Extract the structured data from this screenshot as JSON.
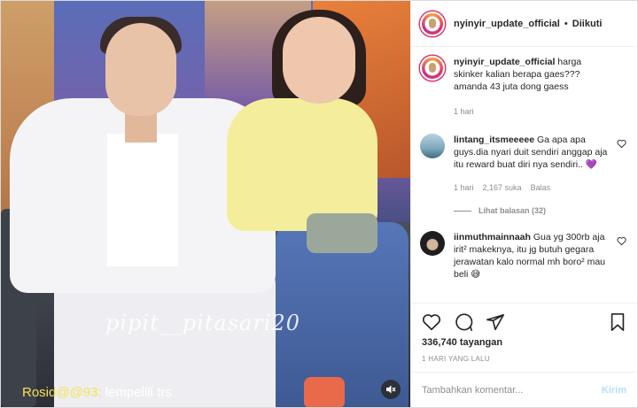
{
  "media": {
    "watermark": "pipit__pitasari20",
    "overlay_caption_user": "Rosid@@93:",
    "overlay_caption_text": "lempellll trs",
    "sound_icon": "speaker-muted-icon"
  },
  "header": {
    "username": "nyinyir_update_official",
    "separator": "•",
    "follow_state": "Diikuti"
  },
  "caption": {
    "username": "nyinyir_update_official",
    "text": "harga skinker kalian berapa gaes???",
    "line2": "amanda 43 juta dong gaess",
    "time": "1 hari"
  },
  "comments": [
    {
      "username": "lintang_itsmeeeee",
      "text": "Ga apa apa guys.dia nyari duit sendiri anggap aja itu reward buat diri nya sendiri..",
      "emoji": "💜",
      "time": "1 hari",
      "likes": "2,167 suka",
      "reply": "Balas",
      "view_replies": "Lihat balasan (32)"
    },
    {
      "username": "iinmuthmainnaah",
      "text": "Gua yg 300rb aja irit² makeknya, itu jg butuh gegara jerawatan kalo normal mh boro² mau beli",
      "emoji": "😅"
    }
  ],
  "actions": {
    "views": "336,740 tayangan",
    "date": "1 HARI YANG LALU"
  },
  "comment_box": {
    "placeholder": "Tambahkan komentar...",
    "post_label": "Kirim"
  },
  "colors": {
    "accent_link": "#0095f6",
    "post_disabled": "#b2dffc",
    "muted_text": "#8e8e8e",
    "caption_user_yellow": "#f6e25a"
  }
}
